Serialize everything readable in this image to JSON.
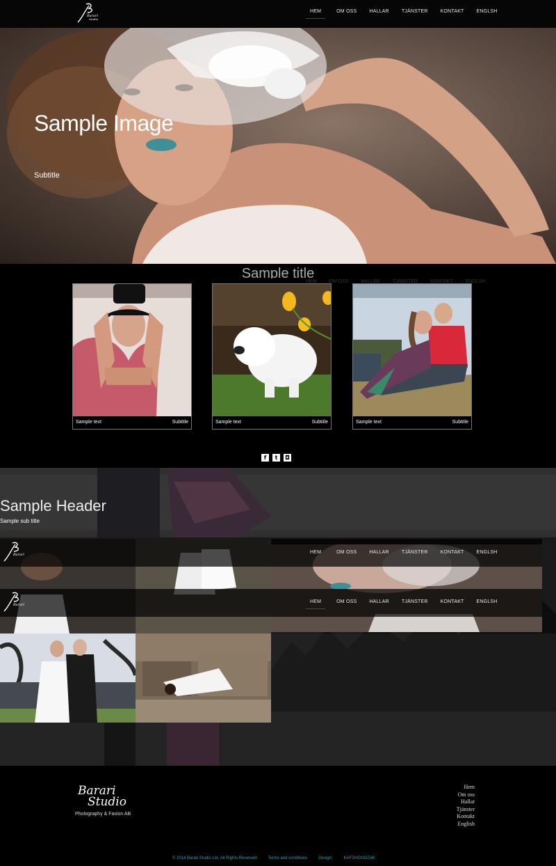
{
  "nav": {
    "logo_text": "Barari Studio",
    "items": [
      {
        "label": "HEM"
      },
      {
        "label": "OM OSS"
      },
      {
        "label": "HALLAR"
      },
      {
        "label": "TJÄNSTER"
      },
      {
        "label": "KONTAKT"
      },
      {
        "label": "ENGLSH"
      }
    ],
    "active": "HEM"
  },
  "hero": {
    "title": "Sample Image",
    "subtitle": "Subtitle"
  },
  "cards_section": {
    "title": "Sample title",
    "cards": [
      {
        "text": "Sample text",
        "subtitle": "Subtitle"
      },
      {
        "text": "Sample text",
        "subtitle": "Subtitle"
      },
      {
        "text": "Sample text",
        "subtitle": "Subtitle"
      }
    ]
  },
  "social": [
    {
      "icon": "facebook-icon",
      "glyph": "f"
    },
    {
      "icon": "twitter-icon",
      "glyph": "t"
    },
    {
      "icon": "instagram-icon",
      "glyph": "◘"
    }
  ],
  "gallery": {
    "header": "Sample Header",
    "sub_title": "Sample sub title"
  },
  "footer": {
    "logo_line1": "Barari",
    "logo_line2": "Studio",
    "tagline": "Photography & Fasion AB",
    "links": [
      "Hem",
      "Om oss",
      "Hallar",
      "Tjänster",
      "Kontakt",
      "English"
    ],
    "copyright": "© 2014 Barari Studio Ltd. All Rights Reserved",
    "terms": "Terms and conditions",
    "design_label": "Design:",
    "designer": "KAFSHDOOZAK"
  },
  "colors": {
    "background": "#000000",
    "footer_accent": "#2aa6b8"
  }
}
